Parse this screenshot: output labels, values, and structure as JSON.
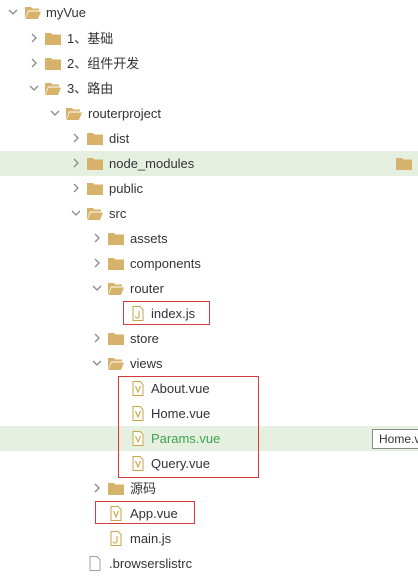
{
  "colors": {
    "folder": "#d7b26a",
    "file_outline": "#c8a64a",
    "chevron": "#8a8a8a",
    "highlight_row": "#e6f0e1",
    "red_box": "#d93a3a",
    "modified_text": "#3fa34d"
  },
  "tree": {
    "items": [
      {
        "label": "myVue",
        "type": "folder",
        "expanded": true
      },
      {
        "label": "1、基础",
        "type": "folder",
        "expanded": false
      },
      {
        "label": "2、组件开发",
        "type": "folder",
        "expanded": false
      },
      {
        "label": "3、路由",
        "type": "folder",
        "expanded": true
      },
      {
        "label": "routerproject",
        "type": "folder",
        "expanded": true
      },
      {
        "label": "dist",
        "type": "folder",
        "expanded": false
      },
      {
        "label": "node_modules",
        "type": "folder",
        "expanded": false,
        "highlighted": true
      },
      {
        "label": "public",
        "type": "folder",
        "expanded": false
      },
      {
        "label": "src",
        "type": "folder",
        "expanded": true
      },
      {
        "label": "assets",
        "type": "folder",
        "expanded": false
      },
      {
        "label": "components",
        "type": "folder",
        "expanded": false
      },
      {
        "label": "router",
        "type": "folder",
        "expanded": true
      },
      {
        "label": "index.js",
        "type": "file",
        "boxed": true
      },
      {
        "label": "store",
        "type": "folder",
        "expanded": false
      },
      {
        "label": "views",
        "type": "folder",
        "expanded": true
      },
      {
        "label": "About.vue",
        "type": "file"
      },
      {
        "label": "Home.vue",
        "type": "file"
      },
      {
        "label": "Params.vue",
        "type": "file",
        "highlighted": true,
        "modified": true
      },
      {
        "label": "Query.vue",
        "type": "file"
      },
      {
        "label": "源码",
        "type": "folder",
        "expanded": false
      },
      {
        "label": "App.vue",
        "type": "file",
        "boxed": true
      },
      {
        "label": "main.js",
        "type": "file"
      },
      {
        "label": ".browserslistrc",
        "type": "file"
      }
    ]
  },
  "tooltip": {
    "text": "Home.v"
  }
}
